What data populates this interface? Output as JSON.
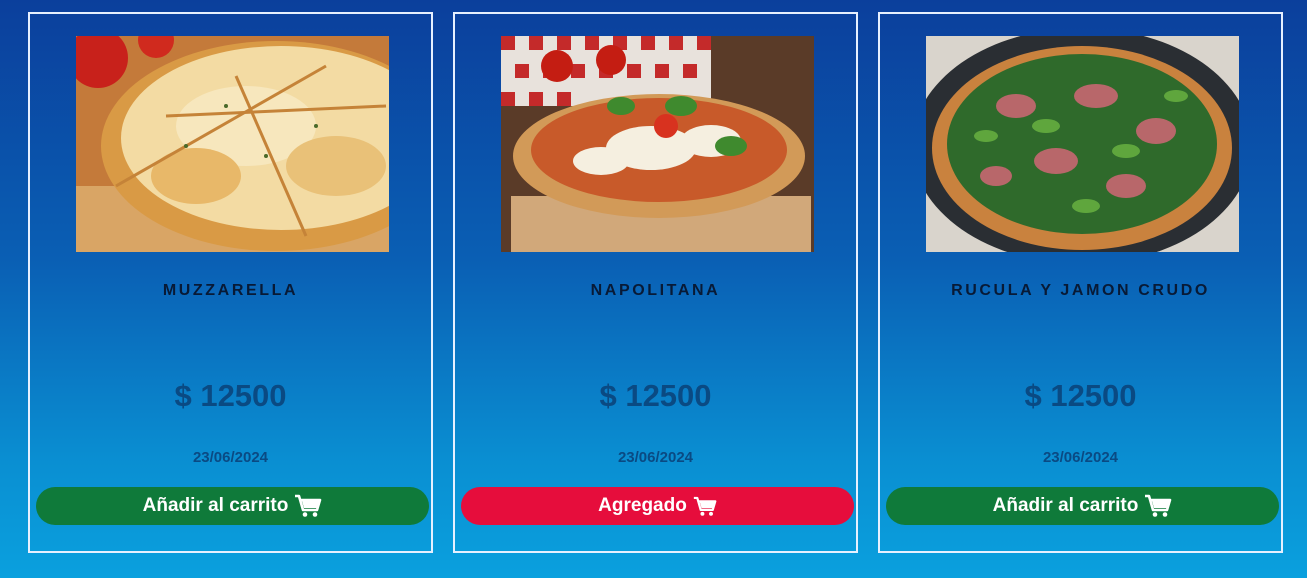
{
  "products": [
    {
      "name": "MUZZARELLA",
      "price": "$ 12500",
      "date": "23/06/2024",
      "button_label": "Añadir al carrito",
      "button_state": "add",
      "button_color": "#0f7a3a",
      "image_icon": "pizza-muzzarella-photo",
      "cart_icon": "shopping-cart-icon"
    },
    {
      "name": "NAPOLITANA",
      "price": "$ 12500",
      "date": "23/06/2024",
      "button_label": "Agregado",
      "button_state": "added",
      "button_color": "#e60d3c",
      "image_icon": "pizza-napolitana-photo",
      "cart_icon": "shopping-cart-icon"
    },
    {
      "name": "RUCULA Y JAMON CRUDO",
      "price": "$ 12500",
      "date": "23/06/2024",
      "button_label": "Añadir al carrito",
      "button_state": "add",
      "button_color": "#0f7a3a",
      "image_icon": "pizza-rucula-photo",
      "cart_icon": "shopping-cart-icon"
    }
  ],
  "theme": {
    "background_top": "#0b3f9c",
    "background_bottom": "#0aa0de",
    "card_border": "#e7f0ff",
    "price_color": "#0a4a83",
    "name_color": "#081a36"
  }
}
